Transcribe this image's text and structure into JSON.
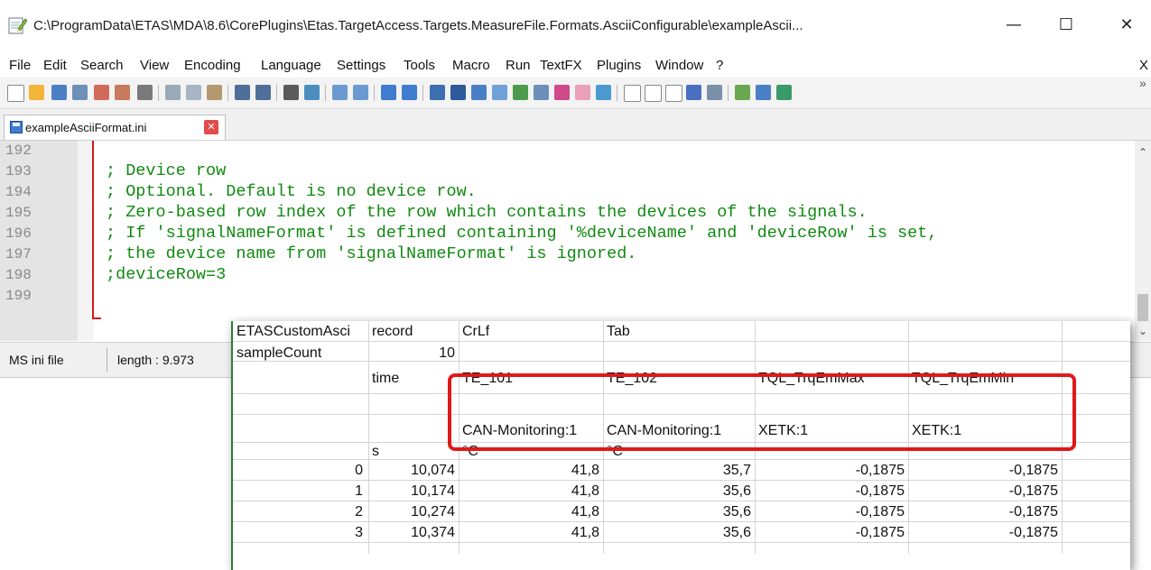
{
  "window": {
    "title": "C:\\ProgramData\\ETAS\\MDA\\8.6\\CorePlugins\\Etas.TargetAccess.Targets.MeasureFile.Formats.AsciiConfigurable\\exampleAscii...",
    "minimize_glyph": "—",
    "maximize_glyph": "☐",
    "close_glyph": "✕"
  },
  "menu": [
    "File",
    "Edit",
    "Search",
    "View",
    "Encoding",
    "Language",
    "Settings",
    "Tools",
    "Macro",
    "Run",
    "TextFX",
    "Plugins",
    "Window",
    "?"
  ],
  "menu_close": "X",
  "toolbar_overflow": "»",
  "tab": {
    "label": "exampleAsciiFormat.ini",
    "close_glyph": "✕"
  },
  "editor": {
    "lines": [
      {
        "num": "192",
        "text": ""
      },
      {
        "num": "193",
        "text": "; Device row"
      },
      {
        "num": "194",
        "text": "; Optional. Default is no device row."
      },
      {
        "num": "195",
        "text": "; Zero-based row index of the row which contains the devices of the signals."
      },
      {
        "num": "196",
        "text": "; If 'signalNameFormat' is defined containing '%deviceName' and 'deviceRow' is set,"
      },
      {
        "num": "197",
        "text": "; the device name from 'signalNameFormat' is ignored."
      },
      {
        "num": "198",
        "text": ";deviceRow=3"
      },
      {
        "num": "199",
        "text": ""
      }
    ],
    "code_color": "#118a11"
  },
  "statusbar": {
    "language": "MS ini file",
    "length": "length : 9.973"
  },
  "sheet": {
    "rows": [
      [
        "ETASCustomAsci",
        "record",
        "CrLf",
        "Tab",
        "",
        ""
      ],
      [
        "sampleCount",
        "10",
        "",
        "",
        "",
        ""
      ],
      [
        "",
        "time",
        "TE_101",
        "TE_102",
        "TQL_TrqEmMax",
        "TQL_TrqEmMin"
      ],
      [
        "",
        "",
        "",
        "",
        "",
        ""
      ],
      [
        "",
        "",
        "CAN-Monitoring:1",
        "CAN-Monitoring:1",
        "XETK:1",
        "XETK:1"
      ],
      [
        "",
        "s",
        "°C",
        "°C",
        "",
        ""
      ],
      [
        "0",
        "10,074",
        "41,8",
        "35,7",
        "-0,1875",
        "-0,1875"
      ],
      [
        "1",
        "10,174",
        "41,8",
        "35,6",
        "-0,1875",
        "-0,1875"
      ],
      [
        "2",
        "10,274",
        "41,8",
        "35,6",
        "-0,1875",
        "-0,1875"
      ],
      [
        "3",
        "10,374",
        "41,8",
        "35,6",
        "-0,1875",
        "-0,1875"
      ]
    ],
    "highlight_color": "#e01818"
  }
}
